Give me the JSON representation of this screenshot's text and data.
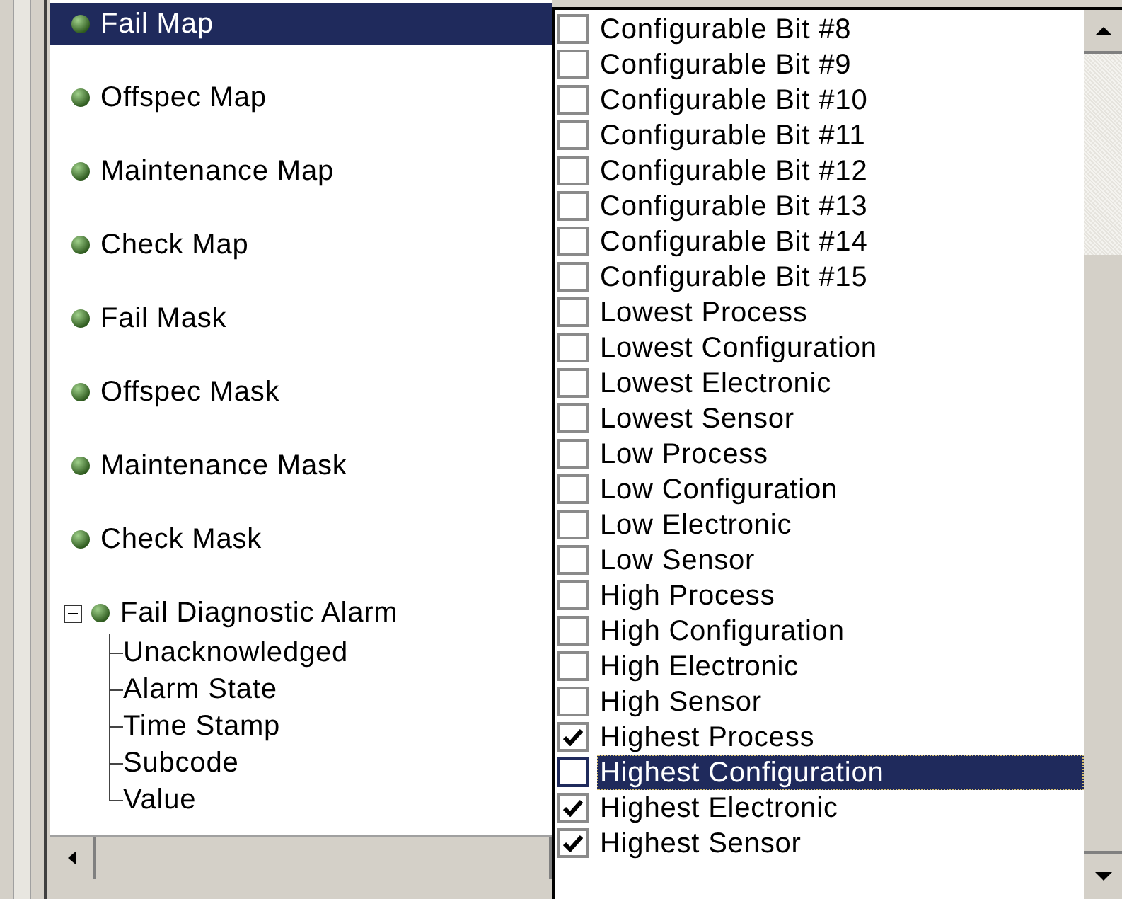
{
  "tree": {
    "items": [
      {
        "label": "Fail Map",
        "selected": true
      },
      {
        "label": "Offspec Map",
        "selected": false
      },
      {
        "label": "Maintenance Map",
        "selected": false
      },
      {
        "label": "Check Map",
        "selected": false
      },
      {
        "label": "Fail Mask",
        "selected": false
      },
      {
        "label": "Offspec Mask",
        "selected": false
      },
      {
        "label": "Maintenance Mask",
        "selected": false
      },
      {
        "label": "Check Mask",
        "selected": false
      },
      {
        "label": "Fail Diagnostic Alarm",
        "selected": false,
        "expanded": true,
        "children": [
          {
            "label": "Unacknowledged"
          },
          {
            "label": "Alarm State"
          },
          {
            "label": "Time Stamp"
          },
          {
            "label": "Subcode"
          },
          {
            "label": "Value"
          }
        ]
      }
    ]
  },
  "checklist": {
    "items": [
      {
        "label": "Configurable Bit #8",
        "checked": false,
        "selected": false
      },
      {
        "label": "Configurable Bit #9",
        "checked": false,
        "selected": false
      },
      {
        "label": "Configurable Bit #10",
        "checked": false,
        "selected": false
      },
      {
        "label": "Configurable Bit #11",
        "checked": false,
        "selected": false
      },
      {
        "label": "Configurable Bit #12",
        "checked": false,
        "selected": false
      },
      {
        "label": "Configurable Bit #13",
        "checked": false,
        "selected": false
      },
      {
        "label": "Configurable Bit #14",
        "checked": false,
        "selected": false
      },
      {
        "label": "Configurable Bit #15",
        "checked": false,
        "selected": false
      },
      {
        "label": "Lowest Process",
        "checked": false,
        "selected": false
      },
      {
        "label": "Lowest Configuration",
        "checked": false,
        "selected": false
      },
      {
        "label": "Lowest Electronic",
        "checked": false,
        "selected": false
      },
      {
        "label": "Lowest Sensor",
        "checked": false,
        "selected": false
      },
      {
        "label": "Low Process",
        "checked": false,
        "selected": false
      },
      {
        "label": "Low Configuration",
        "checked": false,
        "selected": false
      },
      {
        "label": "Low Electronic",
        "checked": false,
        "selected": false
      },
      {
        "label": "Low Sensor",
        "checked": false,
        "selected": false
      },
      {
        "label": "High Process",
        "checked": false,
        "selected": false
      },
      {
        "label": "High Configuration",
        "checked": false,
        "selected": false
      },
      {
        "label": "High Electronic",
        "checked": false,
        "selected": false
      },
      {
        "label": "High Sensor",
        "checked": false,
        "selected": false
      },
      {
        "label": "Highest Process",
        "checked": true,
        "selected": false
      },
      {
        "label": "Highest Configuration",
        "checked": false,
        "selected": true
      },
      {
        "label": "Highest Electronic",
        "checked": true,
        "selected": false
      },
      {
        "label": "Highest Sensor",
        "checked": true,
        "selected": false
      }
    ]
  }
}
